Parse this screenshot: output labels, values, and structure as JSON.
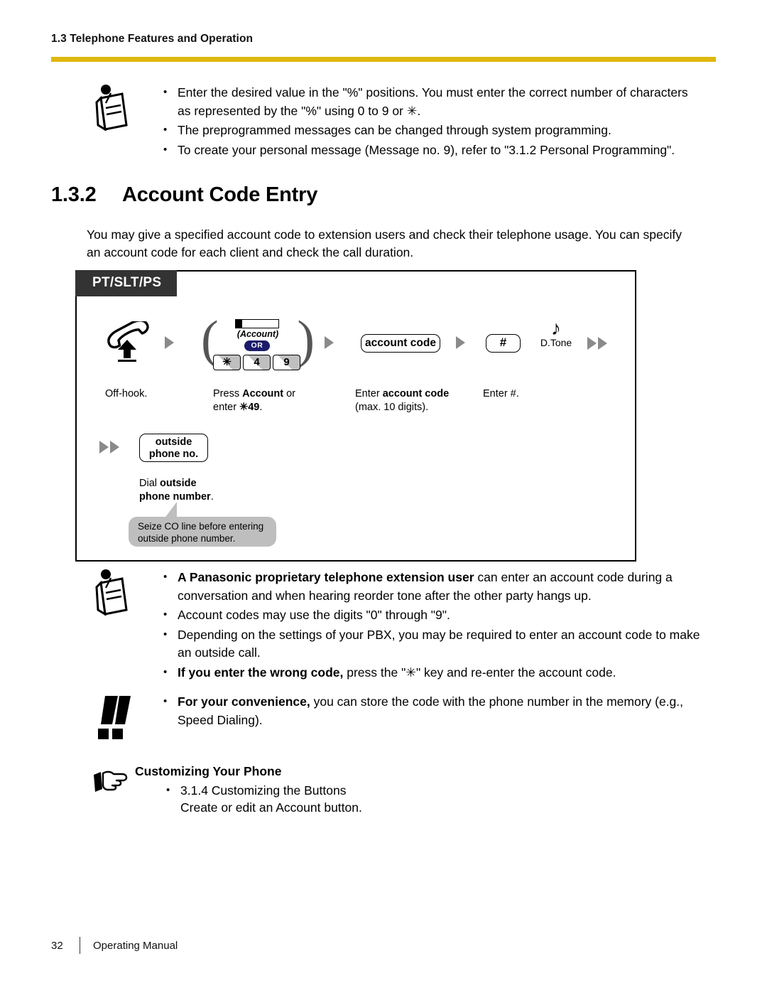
{
  "header": {
    "section_title": "1.3 Telephone Features and Operation",
    "rule_color": "#dfb80c"
  },
  "top_notes": {
    "icon": "note-pushpin-icon",
    "bullets": [
      "Enter the desired value in the \"%\" positions. You must enter the correct number of characters as represented by the \"%\" using 0 to 9 or ✳.",
      "The preprogrammed messages can be changed through system programming.",
      "To create your personal message (Message no. 9), refer to \"3.1.2 Personal Programming\"."
    ]
  },
  "section": {
    "number": "1.3.2",
    "title": "Account Code Entry",
    "intro": "You may give a specified account code to extension users and check their telephone usage. You can specify an account code for each client and check the call duration."
  },
  "diagram": {
    "tag": "PT/SLT/PS",
    "steps": [
      {
        "icon": "off-hook-handset-icon",
        "caption": "Off-hook."
      },
      {
        "account_key_label": "(Account)",
        "or_label": "OR",
        "keys": [
          "✳",
          "4",
          "9"
        ],
        "caption_lead": "Press ",
        "caption_bold": "Account",
        "caption_mid": " or",
        "caption_line2_lead": "enter ",
        "caption_line2_bold": "✳49",
        "caption_line2_tail": "."
      },
      {
        "pill": "account code",
        "caption_lead": "Enter ",
        "caption_bold": "account code",
        "caption_line2": "(max. 10 digits)."
      },
      {
        "pill": "#",
        "caption": "Enter #.",
        "tone_glyph": "♪",
        "tone_label": "D.Tone"
      },
      {
        "pill_line1": "outside",
        "pill_line2": "phone no.",
        "caption_lead": "Dial ",
        "caption_bold": "outside",
        "caption_line2_bold": "phone number",
        "caption_line2_tail": "."
      }
    ],
    "callout": "Seize CO line before entering outside phone number.",
    "callout_color": "#bebebe",
    "tag_bg": "#333333"
  },
  "bottom_notes": {
    "icon": "note-pushpin-icon",
    "bullets": [
      {
        "bold": "A Panasonic proprietary telephone extension user",
        "rest": " can enter an account code during a conversation and when hearing reorder tone after the other party hangs up."
      },
      {
        "bold": "",
        "rest": "Account codes may use the digits \"0\" through \"9\"."
      },
      {
        "bold": "",
        "rest": "Depending on the settings of your PBX, you may be required to enter an account code to make an outside call."
      },
      {
        "bold": "If you enter the wrong code,",
        "rest": " press the \"✳\" key and re-enter the account code."
      }
    ]
  },
  "tip_note": {
    "icon": "double-exclamation-icon",
    "bold": "For your convenience,",
    "rest": " you can store the code with the phone number in the memory (e.g., Speed Dialing)."
  },
  "customizing": {
    "icon": "pointing-hand-icon",
    "heading": "Customizing Your Phone",
    "items": [
      "3.1.4 Customizing the Buttons",
      "Create or edit an Account button."
    ]
  },
  "footer": {
    "page_number": "32",
    "label": "Operating Manual"
  }
}
